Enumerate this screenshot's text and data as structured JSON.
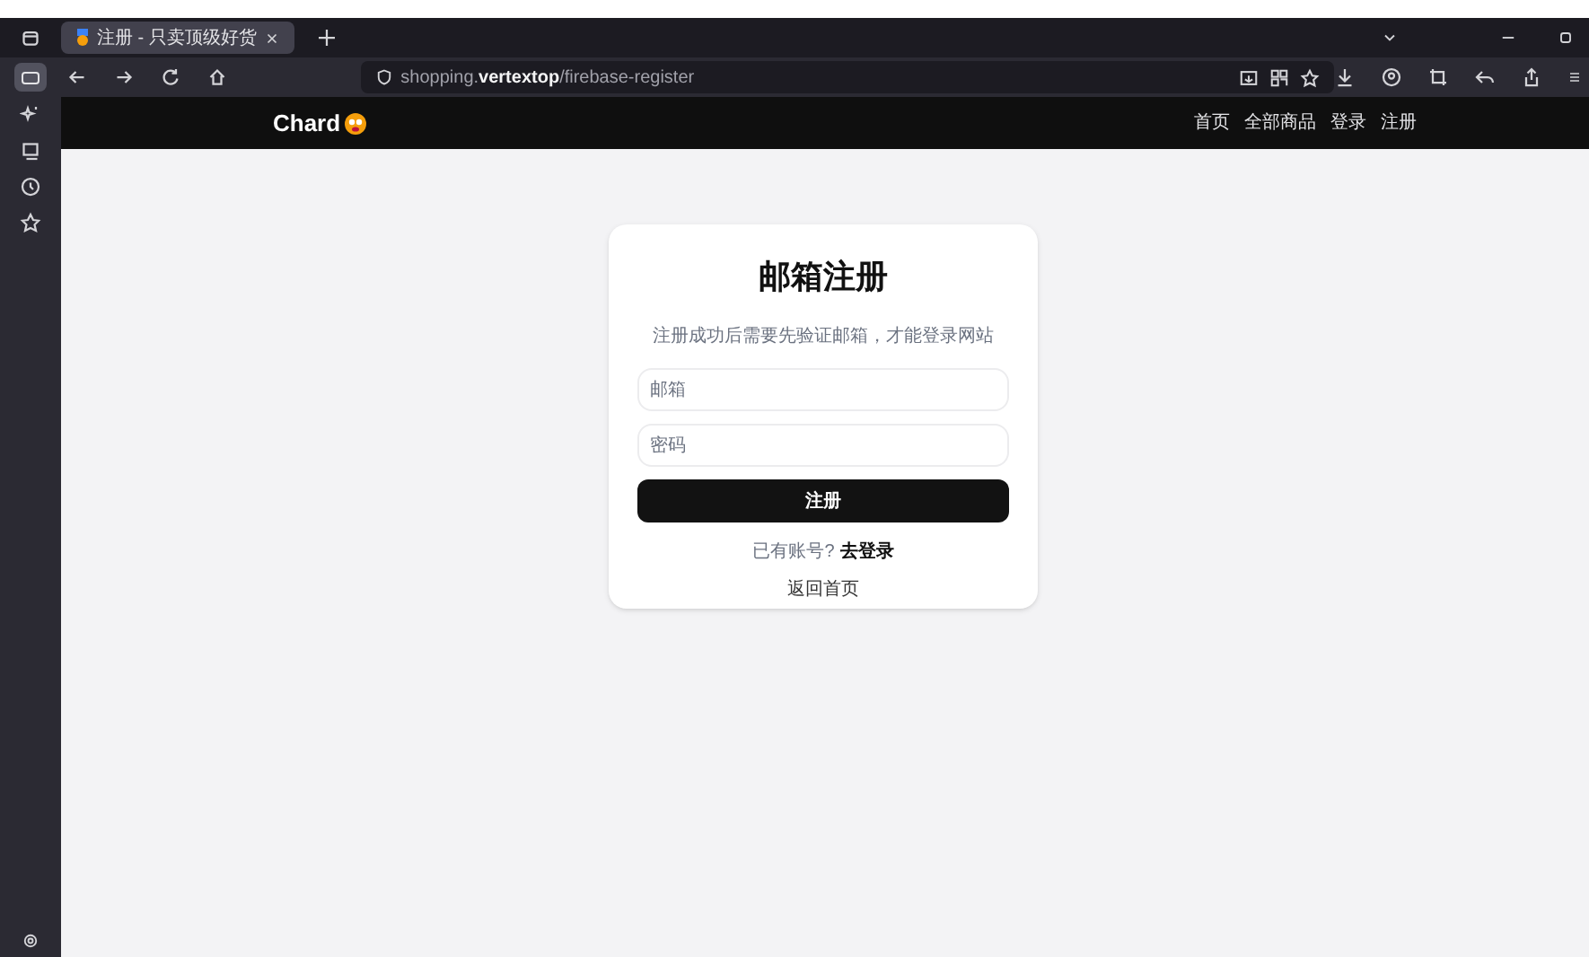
{
  "browser": {
    "tab": {
      "title": "注册 - 只卖顶级好货",
      "selected": true
    },
    "url": {
      "host_prefix": "shopping.",
      "host_main": "vertextop",
      "path": "/firebase-register"
    }
  },
  "site": {
    "logo": "Chard",
    "nav": [
      {
        "label": "首页"
      },
      {
        "label": "全部商品"
      },
      {
        "label": "登录"
      },
      {
        "label": "注册"
      }
    ]
  },
  "form": {
    "title": "邮箱注册",
    "subtitle": "注册成功后需要先验证邮箱，才能登录网站",
    "fields": [
      {
        "placeholder": "邮箱"
      },
      {
        "placeholder": "密码"
      }
    ],
    "submit": "注册",
    "login_prompt": "已有账号?",
    "login_link": "去登录",
    "home_link": "返回首页"
  }
}
